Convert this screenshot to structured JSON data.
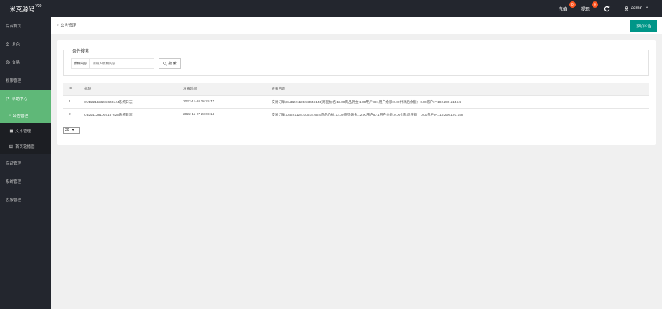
{
  "header": {
    "logo_text": "米克源码",
    "logo_version": "V20",
    "recharge_label": "充值",
    "recharge_badge": "0",
    "withdraw_label": "提现",
    "withdraw_badge": "0",
    "user_label": "admin",
    "refresh_icon": "refresh-icon",
    "user_icon": "user-icon",
    "accent_color": "#ff5722"
  },
  "sidebar": {
    "items": [
      {
        "label": "后台首页"
      },
      {
        "label": "角色",
        "icon": "user-icon"
      },
      {
        "label": "交易",
        "icon": "globe-icon"
      },
      {
        "label": "权限管理"
      },
      {
        "label": "帮助中心",
        "icon": "flag-icon"
      },
      {
        "label": "公告管理",
        "icon": "dot-icon"
      },
      {
        "label": "文本管理",
        "icon": "book-icon"
      },
      {
        "label": "首页轮播图",
        "icon": "image-icon"
      },
      {
        "label": "商品管理"
      },
      {
        "label": "系统管理"
      },
      {
        "label": "客服管理"
      }
    ],
    "active_color": "#5fb878",
    "bg_color": "#23262e"
  },
  "breadcrumb": {
    "separator": "»",
    "current": "公告管理"
  },
  "actions": {
    "add_label": "添加公告",
    "add_color": "#009688"
  },
  "search": {
    "legend": "条件搜索",
    "field_label": "模糊内容",
    "placeholder": "请输入模糊内容",
    "value": "",
    "button_label": "搜 索"
  },
  "table": {
    "headers": [
      "ID",
      "标题",
      "发表时间",
      "查看内容"
    ],
    "rows": [
      [
        "1",
        "SUB221123233643144系统日志",
        "2022-11-26 06:25:47",
        "交易订单(SUB221123233643144)商品价格:12.00商品佣金:1.00用户ID:1用户余额:0.00付款后余额：0.00客户IP:182.239.114.34"
      ],
      [
        "2",
        "UB221128100515762S系统日志",
        "2022-11-27 23:08:14",
        "交易订单:UB221128100515762S商品价格:12.00商品佣金:12.00用户ID:1用户余额:0.00付款后余额：0.00客户IP:116.206.101.158"
      ]
    ]
  },
  "pagination": {
    "page_size": "20"
  }
}
